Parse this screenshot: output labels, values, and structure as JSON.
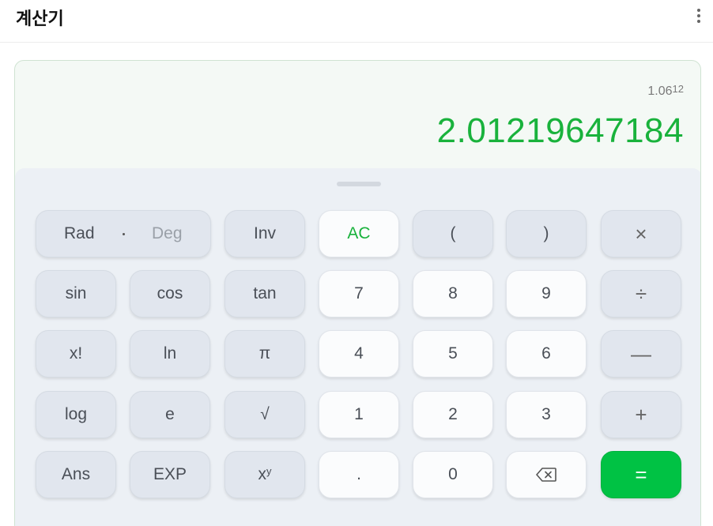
{
  "header": {
    "title": "계산기",
    "more_icon": "more-vertical-icon"
  },
  "display": {
    "expression_base": "1.06",
    "expression_exponent": "12",
    "result": "2.01219647184"
  },
  "colors": {
    "accent": "#19b23c",
    "equals_bg": "#00c244"
  },
  "keys": {
    "rad": "Rad",
    "deg": "Deg",
    "inv": "Inv",
    "ac": "AC",
    "lparen": "(",
    "rparen": ")",
    "multiply": "×",
    "sin": "sin",
    "cos": "cos",
    "tan": "tan",
    "seven": "7",
    "eight": "8",
    "nine": "9",
    "divide": "÷",
    "factorial": "x!",
    "ln": "ln",
    "pi": "π",
    "four": "4",
    "five": "5",
    "six": "6",
    "minus": "—",
    "log": "log",
    "e": "e",
    "sqrt": "√",
    "one": "1",
    "two": "2",
    "three": "3",
    "plus": "+",
    "ans": "Ans",
    "exp": "EXP",
    "power_base": "x",
    "power_exp": "y",
    "decimal": ".",
    "zero": "0",
    "backspace_icon": "backspace-icon",
    "equals": "="
  }
}
